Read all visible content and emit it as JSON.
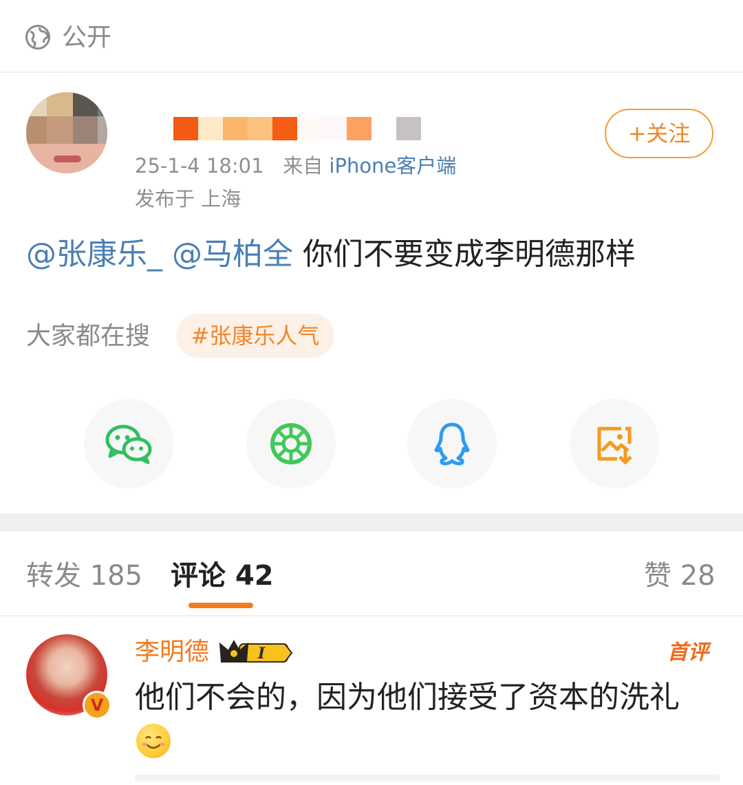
{
  "header": {
    "visibility_label": "公开",
    "visibility_icon": "globe-icon"
  },
  "post": {
    "time": "25-1-4 18:01",
    "from_prefix": "来自",
    "source": "iPhone客户端",
    "location": "发布于 上海",
    "follow_label": "+关注",
    "mentions": [
      "@张康乐_",
      "@马柏全"
    ],
    "text": "你们不要变成李明德那样"
  },
  "trending": {
    "label": "大家都在搜",
    "tag": "#张康乐人气"
  },
  "share": {
    "icons": [
      "wechat-icon",
      "moments-icon",
      "qq-icon",
      "save-image-icon"
    ],
    "colors": {
      "wechat": "#2fbf5f",
      "moments": "#41c85a",
      "qq": "#2d9bf0",
      "save": "#f39a1e"
    }
  },
  "tabs": {
    "repost_label": "转发",
    "repost_count": "185",
    "comment_label": "评论",
    "comment_count": "42",
    "like_label": "赞",
    "like_count": "28"
  },
  "comment": {
    "user": "李明德",
    "badge_level": "I",
    "first_label": "首评",
    "text": "他们不会的，因为他们接受了资本的洗礼",
    "verified_mark": "V"
  },
  "colors": {
    "accent": "#f47c20",
    "link": "#4a7fb4",
    "muted": "#8a8a8a"
  }
}
